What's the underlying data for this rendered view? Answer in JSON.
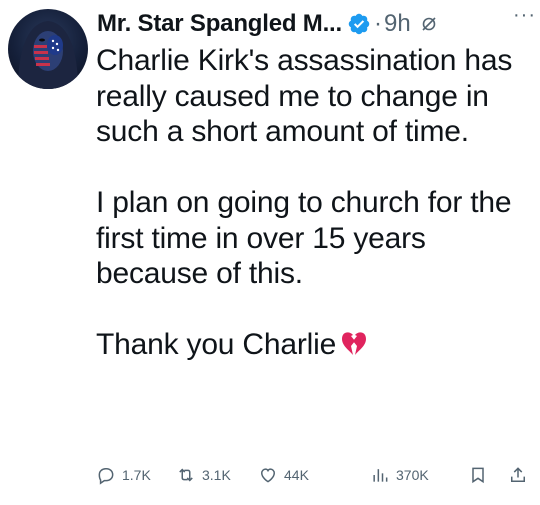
{
  "tweet": {
    "author_name": "Mr. Star Spangled M...",
    "dot": "·",
    "time": "9h",
    "more": "···",
    "paragraphs": [
      "Charlie Kirk's assassination has really caused me to change in such a short amount of time.",
      "I plan on going to church for the first time in over 15 years because of this.",
      "Thank you Charlie"
    ],
    "emoji": "broken-heart"
  },
  "actions": {
    "replies": "1.7K",
    "reposts": "3.1K",
    "likes": "44K",
    "views": "370K"
  },
  "colors": {
    "text": "#0f1419",
    "muted": "#536471",
    "verified": "#1d9bf0",
    "heart": "#e0245e"
  },
  "icons": [
    "avatar",
    "verified-badge-icon",
    "muted-icon",
    "more-icon",
    "broken-heart-icon",
    "reply-icon",
    "repost-icon",
    "like-icon",
    "views-icon",
    "bookmark-icon",
    "share-icon"
  ]
}
